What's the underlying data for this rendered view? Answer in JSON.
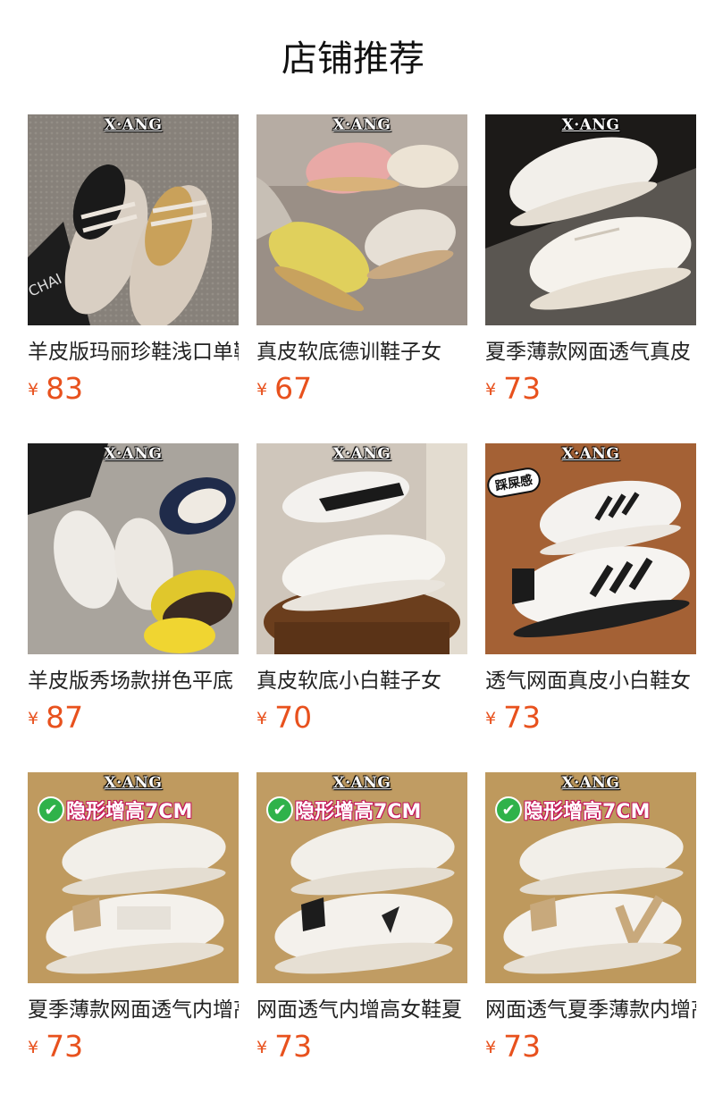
{
  "page": {
    "title": "店铺推荐"
  },
  "products": [
    {
      "name": "羊皮版玛丽珍鞋浅口单鞋",
      "currency": "¥",
      "price": "83",
      "brand": "X·ANG",
      "side_text": "CHAI",
      "badge": ""
    },
    {
      "name": "真皮软底德训鞋子女",
      "currency": "¥",
      "price": "67",
      "brand": "X·ANG",
      "badge": ""
    },
    {
      "name": "夏季薄款网面透气真皮",
      "currency": "¥",
      "price": "73",
      "brand": "X·ANG",
      "badge": ""
    },
    {
      "name": "羊皮版秀场款拼色平底",
      "currency": "¥",
      "price": "87",
      "brand": "X·ANG",
      "badge": ""
    },
    {
      "name": "真皮软底小白鞋子女",
      "currency": "¥",
      "price": "70",
      "brand": "X·ANG",
      "badge": ""
    },
    {
      "name": "透气网面真皮小白鞋女",
      "currency": "¥",
      "price": "73",
      "brand": "X·ANG",
      "sticker": "踩屎感",
      "badge": ""
    },
    {
      "name": "夏季薄款网面透气内增高",
      "currency": "¥",
      "price": "73",
      "brand": "X·ANG",
      "badge": "隐形增高7CM"
    },
    {
      "name": "网面透气内增高女鞋夏",
      "currency": "¥",
      "price": "73",
      "brand": "X·ANG",
      "badge": "隐形增高7CM"
    },
    {
      "name": "网面透气夏季薄款内增高",
      "currency": "¥",
      "price": "73",
      "brand": "X·ANG",
      "badge": "隐形增高7CM"
    }
  ],
  "colors": {
    "price": "#e8511d",
    "badge_check": "#2fb24a",
    "badge_text_outline": "#c4145a"
  }
}
